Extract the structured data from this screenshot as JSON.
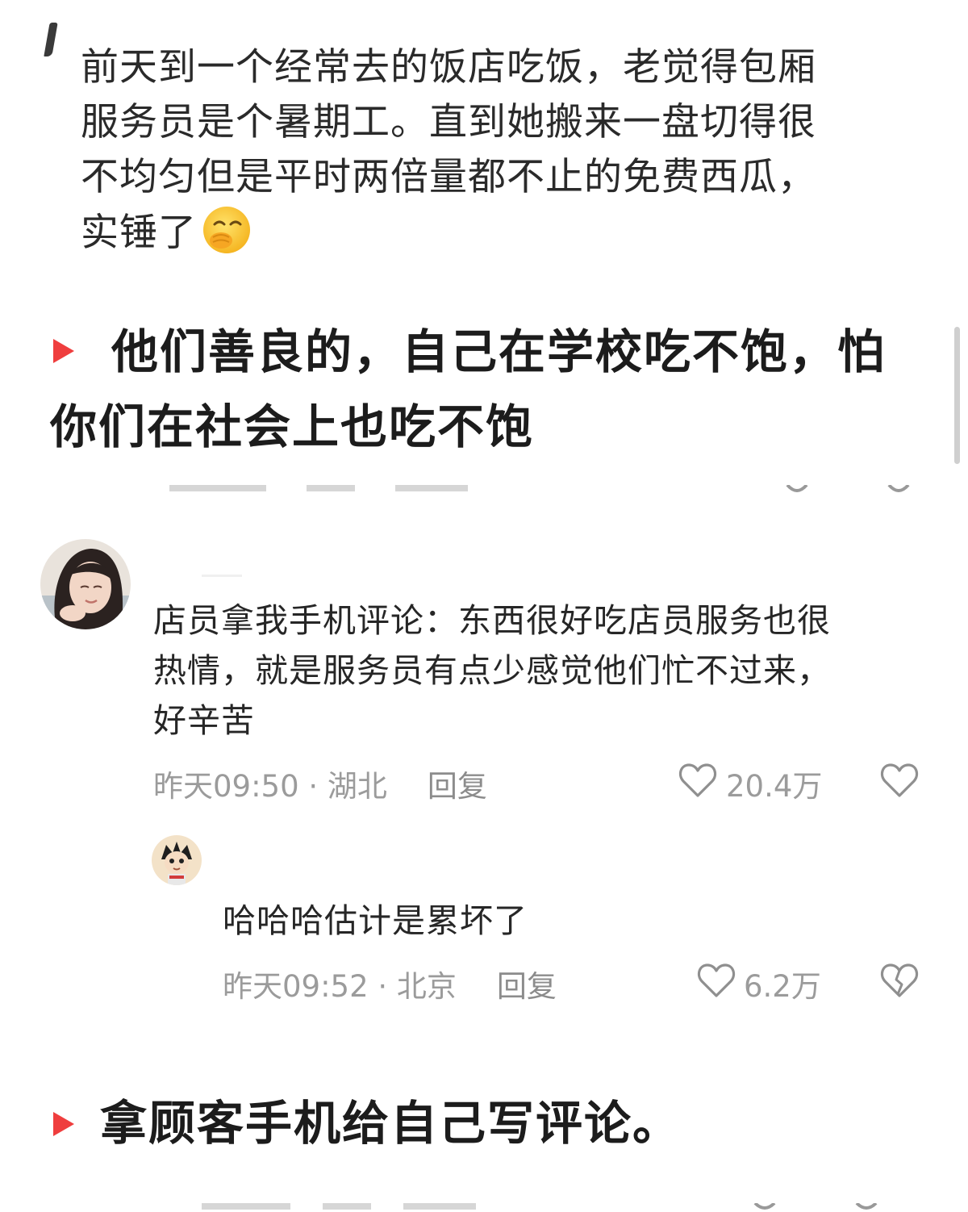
{
  "post": {
    "text_lines": [
      "前天到一个经常去的饭店吃饭，老觉得包厢",
      "服务员是个暑期工。直到她搬来一盘切得很",
      "不均匀但是平时两倍量都不止的免费西瓜，",
      "实锤了"
    ],
    "emoji": "smirking-face-with-hand"
  },
  "caption1": {
    "line1": "他们善良的，自己在学校吃不饱，怕",
    "line2": "你们在社会上也吃不饱"
  },
  "comment": {
    "text_lines": [
      "店员拿我手机评论：东西很好吃店员服务也很",
      "热情，就是服务员有点少感觉他们忙不过来，",
      "好辛苦"
    ],
    "meta": "昨天09:50 · 湖北",
    "reply_label": "回复",
    "likes": "20.4万"
  },
  "reply": {
    "text": "哈哈哈估计是累坏了",
    "meta": "昨天09:52 · 北京",
    "reply_label": "回复",
    "likes": "6.2万"
  },
  "caption2": {
    "text": "拿顾客手机给自己写评论。"
  },
  "colors": {
    "accent_red": "#ef3e3e",
    "meta_gray": "#9b9b9b"
  }
}
